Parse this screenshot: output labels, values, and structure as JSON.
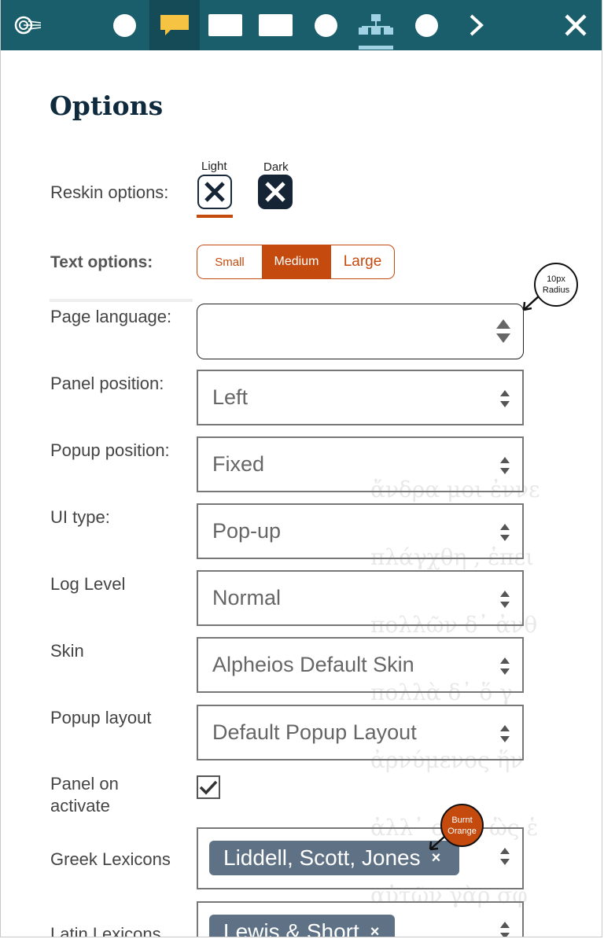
{
  "toolbar": {
    "icons": [
      "alpheios-logo-icon",
      "circle-icon",
      "comment-icon",
      "rectangle-icon",
      "rectangle-icon",
      "circle-icon",
      "tree-icon",
      "circle-icon",
      "chevron-right-icon",
      "close-icon"
    ]
  },
  "background_text": [
    "ἄνδρα μοι ἐννε",
    "πλάγχθη , ἐπει",
    "πολλῶν δ᾽ ἀνθ",
    "πολλὰ δ᾽ ὅ γ",
    "ἀρνύμενος ἥν",
    "ἀλλ᾽ οὐδ᾽ ὣς ἑ",
    "αὐτῶν γὰρ σφ"
  ],
  "page": {
    "title": "Options"
  },
  "reskin": {
    "label": "Reskin options:",
    "light_label": "Light",
    "dark_label": "Dark"
  },
  "text_options": {
    "label": "Text options:",
    "small": "Small",
    "medium": "Medium",
    "large": "Large",
    "selected": "Medium"
  },
  "fields": {
    "page_language": {
      "label": "Page language:",
      "value": ""
    },
    "panel_position": {
      "label": "Panel position:",
      "value": "Left"
    },
    "popup_position": {
      "label": "Popup position:",
      "value": "Fixed"
    },
    "ui_type": {
      "label": "UI type:",
      "value": "Pop-up"
    },
    "log_level": {
      "label": "Log Level",
      "value": "Normal"
    },
    "skin": {
      "label": "Skin",
      "value": "Alpheios Default Skin"
    },
    "popup_layout": {
      "label": "Popup layout",
      "value": "Default Popup Layout"
    },
    "panel_on_activate": {
      "label_line1": "Panel on",
      "label_line2": "activate",
      "checked": true
    },
    "greek_lexicons": {
      "label": "Greek Lexicons",
      "chip": "Liddell, Scott, Jones",
      "chip_remove": "×"
    },
    "latin_lexicons": {
      "label": "Latin Lexicons",
      "chip": "Lewis & Short",
      "chip_remove": "×"
    }
  },
  "annotations": {
    "radius_line1": "10px",
    "radius_line2": "Radius",
    "color_line1": "Burnt",
    "color_line2": "Orange"
  },
  "colors": {
    "toolbar": "#1b5e6b",
    "accent": "#c54a0e",
    "title": "#0f2a3d",
    "chip": "#5f7285"
  }
}
